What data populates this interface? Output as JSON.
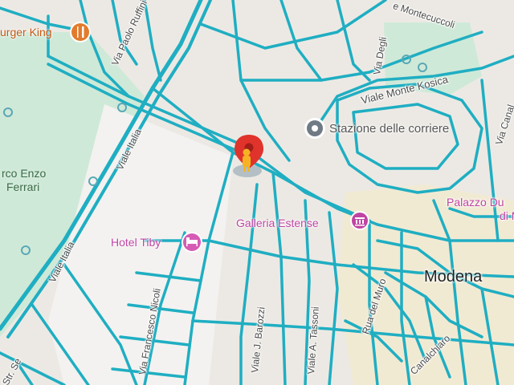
{
  "map": {
    "city_label": "Modena",
    "pois": {
      "burger_king": "urger King",
      "hotel": "Hotel Tiby",
      "bus_station": "Stazione delle corriere",
      "gallery": "Galleria Estense",
      "palazzo_line1": "Palazzo Du",
      "palazzo_line2": "di Mo"
    },
    "park": {
      "line1": "rco Enzo",
      "line2": "Ferrari"
    },
    "streets": {
      "viale_italia_upper": "Viale Italia",
      "viale_italia_lower": "Viale Italia",
      "via_paolo_ruffini": "Via Paolo Ruffini",
      "viale_montecuccoli": "e Montecuccoli",
      "via_degli": "Via Degli",
      "viale_monte_kosica": "Viale Monte Kosica",
      "via_canal": "Via Canal",
      "via_francesco_nicoli": "Via Francesco Nicoli",
      "viale_barozzi": "Viale J. Barozzi",
      "viale_tassoni": "Viale A. Tassoni",
      "rua_del_muro": "Rua del Muro",
      "canalchiaro": "Canalchiaro",
      "str_se": "Str. Se"
    },
    "colors": {
      "land": "#ece9e4",
      "park": "#cfe9d8",
      "historic_center": "#f1ead3",
      "street_overlay": "#1faec2",
      "pin_red": "#e0332b",
      "poi_pink": "#c044a3",
      "bus_gray": "#6f7a84"
    },
    "icons": {
      "restaurant": "fork-knife-icon",
      "hotel": "bed-icon",
      "museum": "museum-icon",
      "bus": "bus-station-icon",
      "location_pin": "location-pin-icon",
      "street_view": "pegman-icon"
    }
  }
}
